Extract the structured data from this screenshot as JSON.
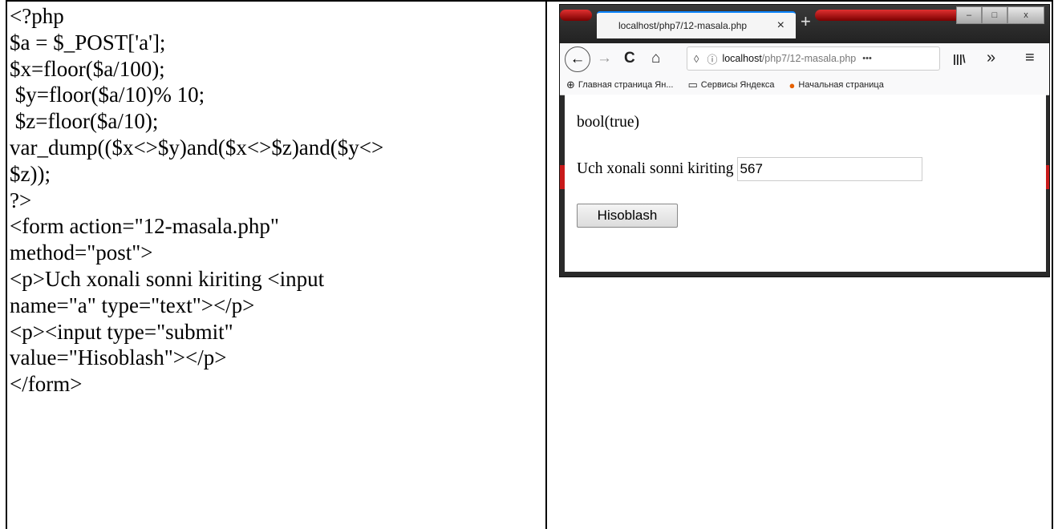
{
  "code_lines": [
    "<?php",
    "$a = $_POST['a'];",
    "$x=floor($a/100);",
    " $y=floor($a/10)% 10;",
    " $z=floor($a/10);",
    "var_dump(($x<>$y)and($x<>$z)and($y<>",
    "$z));",
    "?>",
    "<form action=\"12-masala.php\"",
    "method=\"post\">",
    "<p>Uch xonali sonni kiriting <input",
    "name=\"a\" type=\"text\"></p>",
    "<p><input type=\"submit\"",
    "value=\"Hisoblash\"></p>",
    "</form>"
  ],
  "browser": {
    "tab_title": "localhost/php7/12-masala.php",
    "tab_close": "×",
    "new_tab": "+",
    "window_buttons": {
      "minimize": "–",
      "maximize": "□",
      "close": "x"
    },
    "nav": {
      "back": "←",
      "forward": "→",
      "reload": "C",
      "home": "⌂",
      "url_host": "localhost",
      "url_path": "/php7/12-masala.php",
      "more": "•••",
      "library": "|||\\",
      "overflow": "»",
      "menu": "≡"
    },
    "bookmarks": [
      {
        "icon": "globe-icon",
        "label": "Главная страница Ян..."
      },
      {
        "icon": "folder-icon",
        "label": "Сервисы Яндекса"
      },
      {
        "icon": "firefox-icon",
        "label": "Начальная страница"
      }
    ],
    "page": {
      "result": "bool(true)",
      "prompt": "Uch xonali sonni kiriting",
      "input_value": "567",
      "submit_label": "Hisoblash"
    }
  }
}
